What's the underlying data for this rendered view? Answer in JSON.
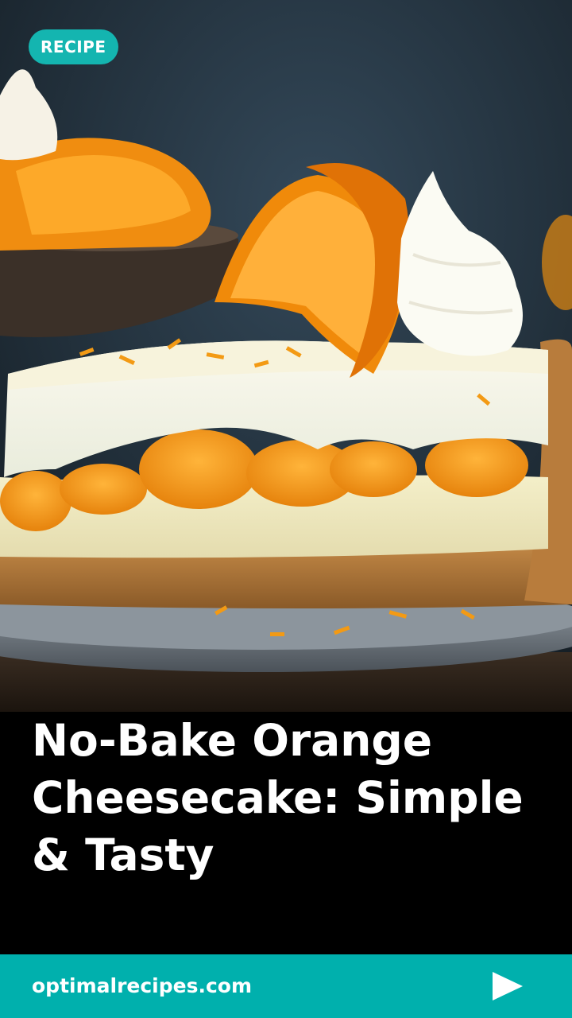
{
  "badge": {
    "label": "RECIPE"
  },
  "story": {
    "title": "No-Bake Orange Cheesecake: Simple & Tasty"
  },
  "footer": {
    "site": "optimalrecipes.com",
    "next_icon": "play-arrow-icon"
  },
  "colors": {
    "accent": "#00b0ad",
    "badge": "#14b5b0",
    "background": "#000000",
    "text": "#ffffff"
  }
}
